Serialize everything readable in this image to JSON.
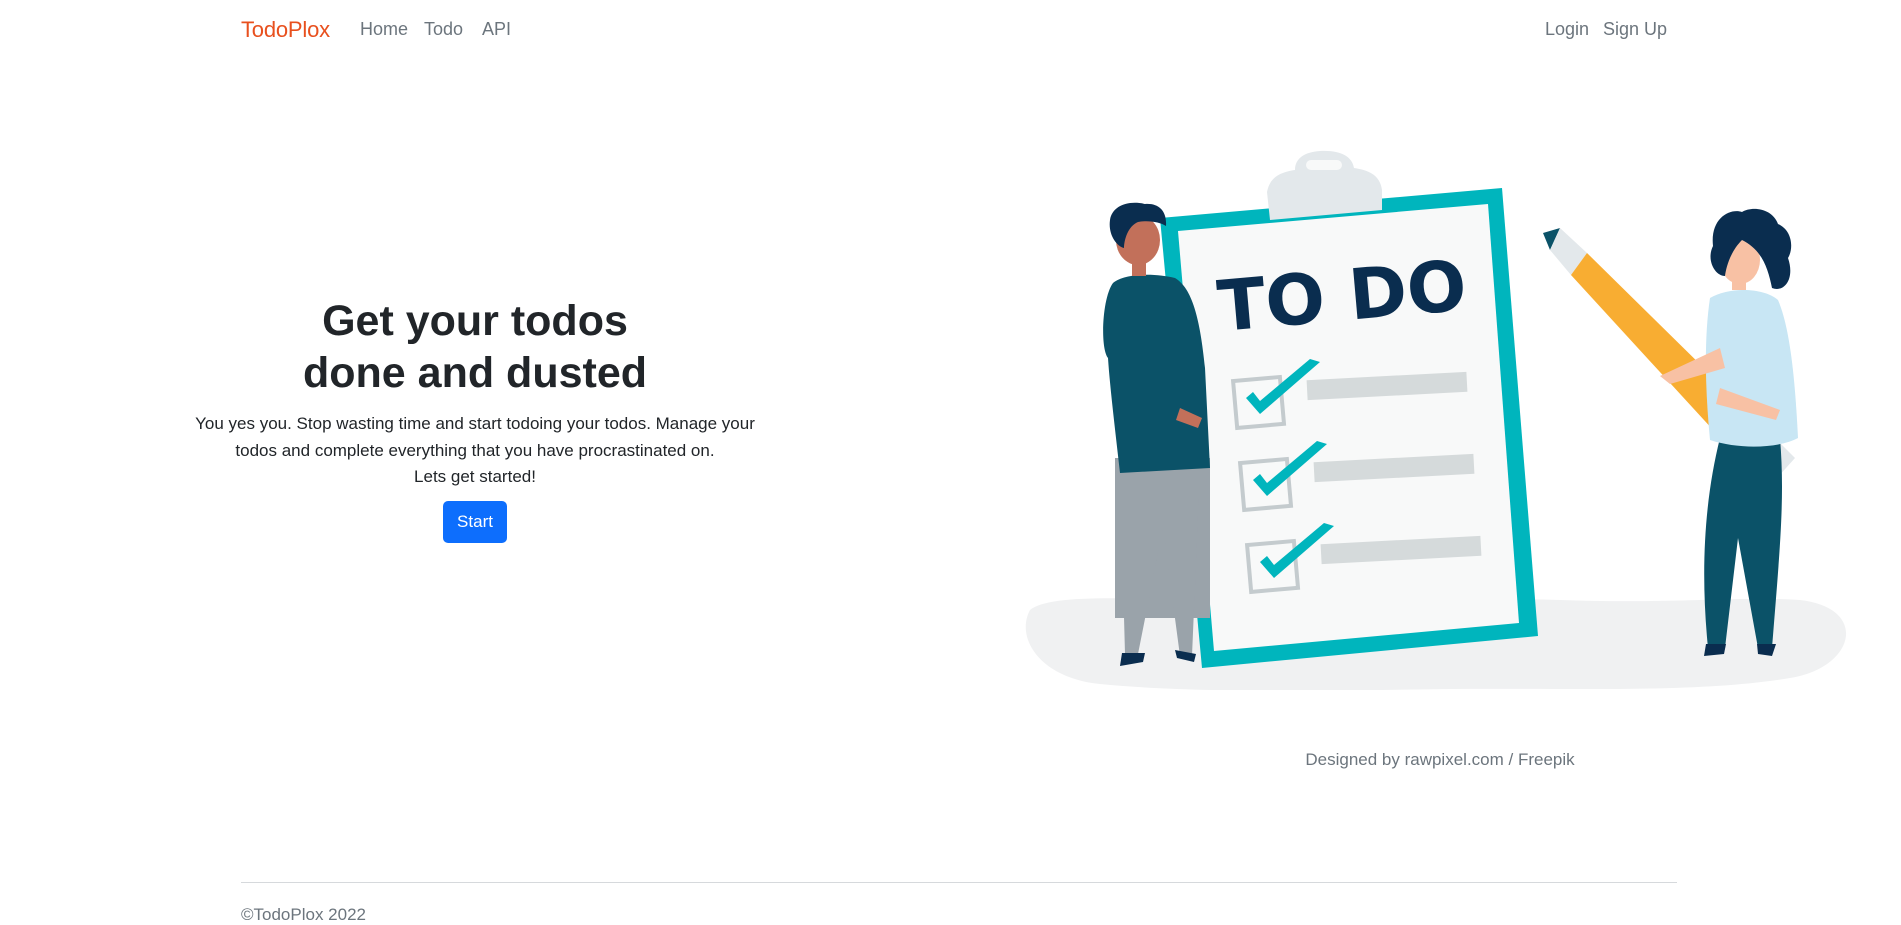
{
  "nav": {
    "brand": "TodoPlox",
    "links": [
      "Home",
      "Todo",
      "API"
    ],
    "login": "Login",
    "signup": "Sign Up"
  },
  "hero": {
    "title_line1": "Get your todos",
    "title_line2": "done and dusted",
    "text_line1": "You yes you. Stop wasting time and start todoing your todos. Manage your",
    "text_line2": "todos and complete everything that you have procrastinated on.",
    "text_line3": "Lets get started!",
    "start_label": "Start"
  },
  "illustration": {
    "board_text": "TO DO"
  },
  "credit": "Designed by rawpixel.com / Freepik",
  "footer": {
    "copyright": "©TodoPlox 2022"
  },
  "colors": {
    "brand": "#e8501e",
    "primary_button": "#0d6efd",
    "teal": "#00b5bd",
    "navy": "#0a2d4f",
    "pencil": "#f8ad32"
  }
}
